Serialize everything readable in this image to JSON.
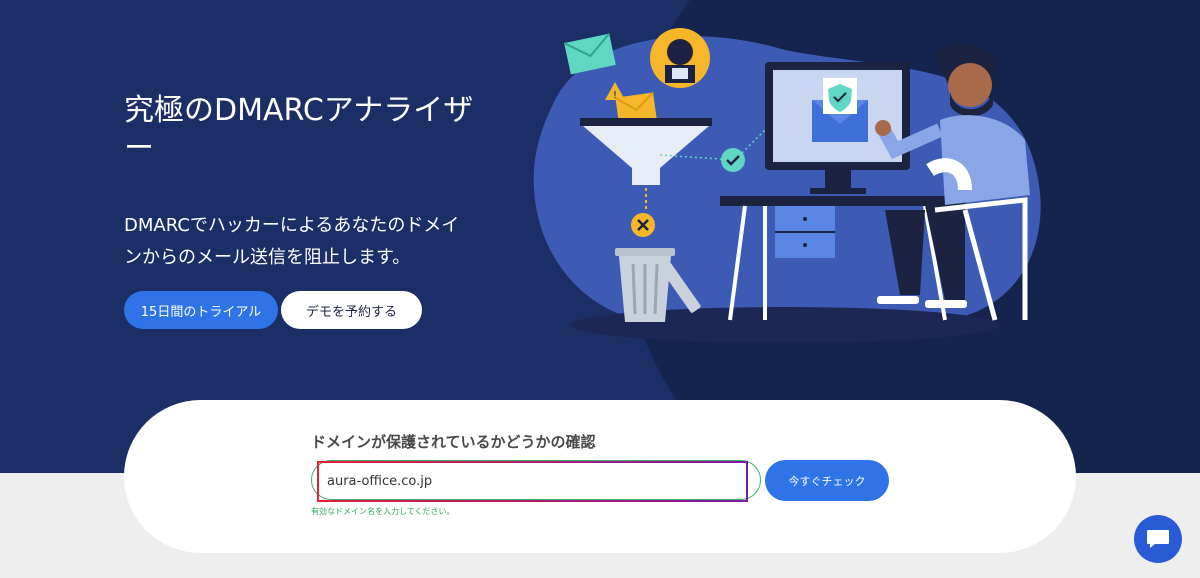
{
  "hero": {
    "headline": "究極のDMARCアナライザー",
    "subtext": "DMARCでハッカーによるあなたのドメインからのメール送信を阻止します。",
    "trial_button": "15日間のトライアル",
    "demo_button": "デモを予約する"
  },
  "checker": {
    "title": "ドメインが保護されているかどうかの確認",
    "input_value": "aura-office.co.jp",
    "check_button": "今すぐチェック",
    "hint": "有効なドメイン名を入力してください。"
  },
  "colors": {
    "hero_bg": "#1b2f66",
    "primary": "#2f73e8",
    "success": "#3bb36b",
    "warning": "#f5b629"
  },
  "icons": [
    "envelope-icon",
    "hacker-icon",
    "warning-icon",
    "funnel-icon",
    "check-icon",
    "x-icon",
    "trash-icon",
    "monitor-icon",
    "shield-check-icon",
    "person-illustration",
    "chat-icon"
  ]
}
